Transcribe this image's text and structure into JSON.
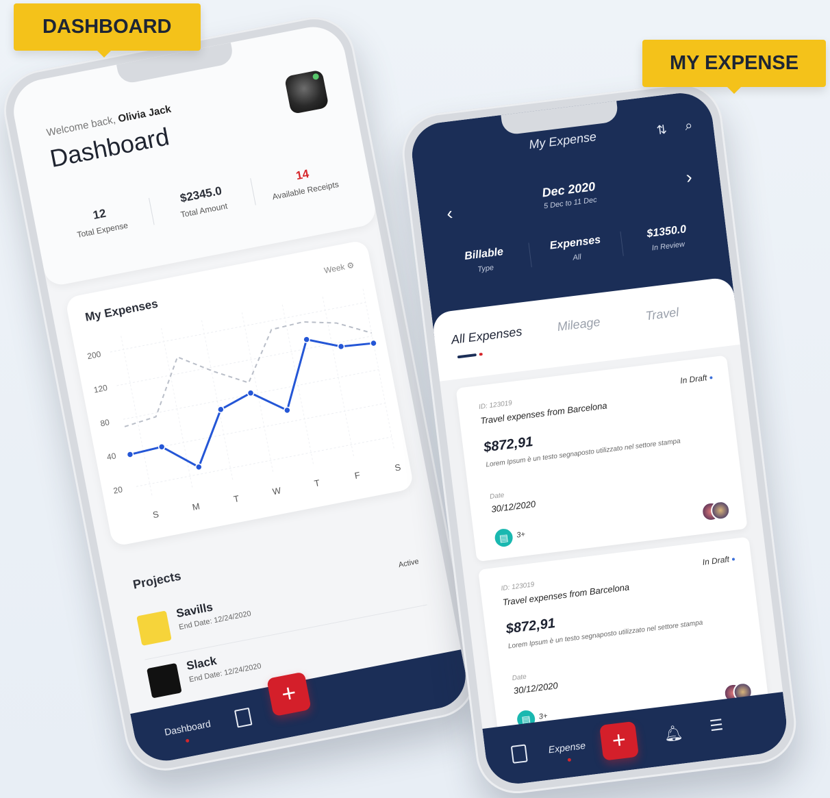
{
  "labels": {
    "dashboard_tag": "DASHBOARD",
    "expense_tag": "MY EXPENSE"
  },
  "dashboard": {
    "welcome_prefix": "Welcome back,",
    "user_name": "Olivia Jack",
    "title": "Dashboard",
    "stats": [
      {
        "value": "12",
        "label": "Total Expense"
      },
      {
        "value": "$2345.0",
        "label": "Total Amount"
      },
      {
        "value": "14",
        "label": "Available Receipts"
      }
    ],
    "card_title": "My Expenses",
    "period": "Week",
    "projects_title": "Projects",
    "projects": [
      {
        "name": "Savills",
        "end_date": "End Date: 12/24/2020",
        "status": "Active",
        "logo_color": "#f6d43a"
      },
      {
        "name": "Slack",
        "end_date": "End Date: 12/24/2020",
        "logo_color": "#111111"
      }
    ],
    "nav": {
      "label": "Dashboard",
      "fab": "+"
    }
  },
  "chart_data": {
    "type": "line",
    "categories": [
      "S",
      "M",
      "T",
      "W",
      "T",
      "F",
      "S"
    ],
    "y_ticks": [
      "200",
      "120",
      "80",
      "40",
      "20"
    ],
    "series": [
      {
        "values": [
          62,
          64,
          28,
          98,
          112,
          80,
          168,
          150,
          146
        ]
      },
      {
        "values": [
          100,
          105,
          178,
          150,
          126,
          190,
          192,
          182,
          160
        ]
      }
    ],
    "colors": {
      "primary": "#2456d6",
      "secondary": "#b9bec8"
    }
  },
  "expense": {
    "title": "My Expense",
    "month": "Dec 2020",
    "range": "5 Dec to 11 Dec",
    "stats": [
      {
        "value": "Billable",
        "label": "Type"
      },
      {
        "value": "Expenses",
        "label": "All"
      },
      {
        "value": "$1350.0",
        "label": "In Review"
      }
    ],
    "tabs": [
      "All Expenses",
      "Mileage",
      "Travel"
    ],
    "cards": [
      {
        "id": "ID: 123019",
        "status": "In Draft",
        "title": "Travel expenses from Barcelona",
        "amount": "$872,91",
        "desc": "Lorem Ipsum è un testo segnaposto utilizzato nel settore stampa",
        "date_label": "Date",
        "date": "30/12/2020",
        "count": "3+"
      },
      {
        "id": "ID: 123019",
        "status": "In Draft",
        "title": "Travel expenses from Barcelona",
        "amount": "$872,91",
        "desc": "Lorem Ipsum è un testo segnaposto utilizzato nel settore stampa",
        "date_label": "Date",
        "date": "30/12/2020",
        "count": "3+"
      }
    ],
    "nav": {
      "expense": "Expense",
      "fab": "+"
    }
  }
}
